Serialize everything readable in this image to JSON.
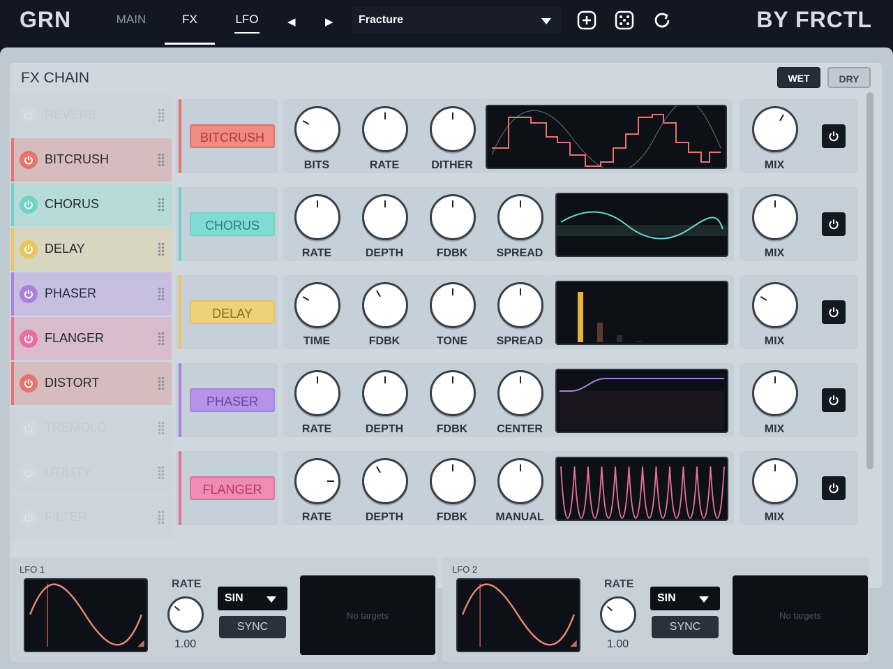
{
  "header": {
    "logo": "GRN",
    "brand": "BY FRCTL",
    "tabs": [
      {
        "label": "MAIN"
      },
      {
        "label": "FX"
      },
      {
        "label": "LFO"
      }
    ],
    "preset_name": "Fracture",
    "icons": [
      "prev-arrow-icon",
      "next-arrow-icon",
      "add-icon",
      "dice-icon",
      "refresh-icon"
    ]
  },
  "fx_chain": {
    "title": "FX CHAIN",
    "wet_label": "WET",
    "dry_label": "DRY",
    "slots": [
      {
        "name": "REVERB",
        "enabled": false
      },
      {
        "name": "BITCRUSH",
        "enabled": true,
        "color": "#e8736c"
      },
      {
        "name": "CHORUS",
        "enabled": true,
        "color": "#6fd3c9"
      },
      {
        "name": "DELAY",
        "enabled": true,
        "color": "#e9c55a"
      },
      {
        "name": "PHASER",
        "enabled": true,
        "color": "#a981e0"
      },
      {
        "name": "FLANGER",
        "enabled": true,
        "color": "#e96f9e"
      },
      {
        "name": "DISTORT",
        "enabled": true,
        "color": "#e8736c"
      },
      {
        "name": "TREMOLO",
        "enabled": false
      },
      {
        "name": "UTILITY",
        "enabled": false
      },
      {
        "name": "FILTER",
        "enabled": false
      }
    ],
    "rows": [
      {
        "name": "BITCRUSH",
        "color": "#e8736c",
        "bg": "#f08a83",
        "knobs": [
          "BITS",
          "RATE",
          "DITHER"
        ],
        "mix": "MIX"
      },
      {
        "name": "CHORUS",
        "color": "#6fd3c9",
        "bg": "#7fdcd2",
        "knobs": [
          "RATE",
          "DEPTH",
          "FDBK",
          "SPREAD"
        ],
        "mix": "MIX"
      },
      {
        "name": "DELAY",
        "color": "#e9c55a",
        "bg": "#eed27a",
        "knobs": [
          "TIME",
          "FDBK",
          "TONE",
          "SPREAD"
        ],
        "mix": "MIX"
      },
      {
        "name": "PHASER",
        "color": "#a981e0",
        "bg": "#b891e8",
        "knobs": [
          "RATE",
          "DEPTH",
          "FDBK",
          "CENTER"
        ],
        "mix": "MIX"
      },
      {
        "name": "FLANGER",
        "color": "#e96f9e",
        "bg": "#ef8cb3",
        "knobs": [
          "RATE",
          "DEPTH",
          "FDBK",
          "MANUAL"
        ],
        "mix": "MIX"
      }
    ]
  },
  "lfos": [
    {
      "title": "LFO 1",
      "rate_label": "RATE",
      "rate_value": "1.00",
      "shape": "SIN",
      "sync_label": "SYNC",
      "targets": "No targets"
    },
    {
      "title": "LFO 2",
      "rate_label": "RATE",
      "rate_value": "1.00",
      "shape": "SIN",
      "sync_label": "SYNC",
      "targets": "No targets"
    }
  ]
}
